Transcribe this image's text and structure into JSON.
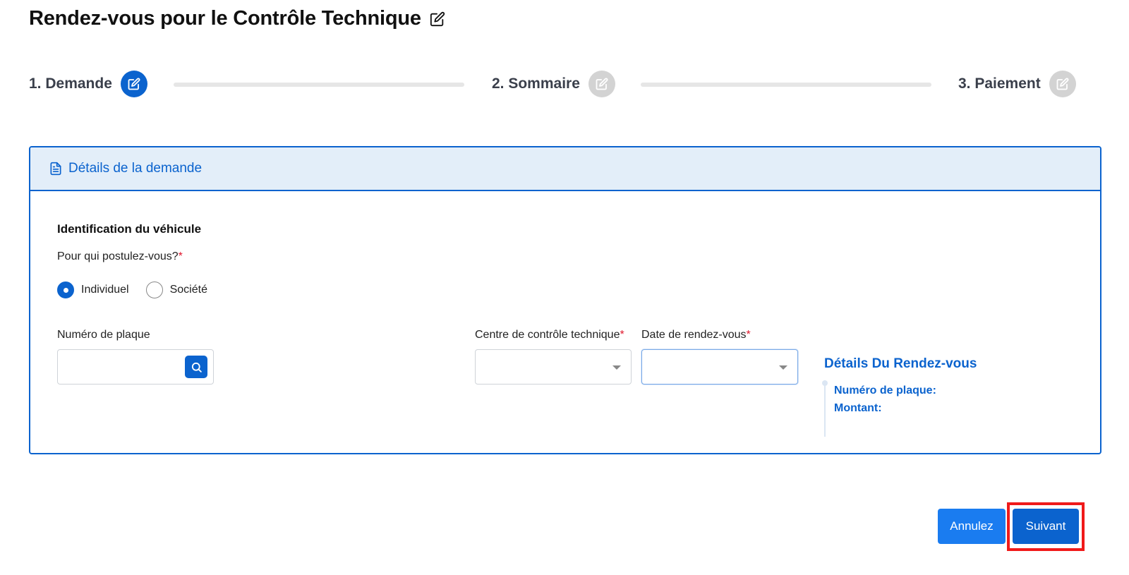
{
  "page": {
    "title": "Rendez-vous pour le Contrôle Technique"
  },
  "stepper": {
    "steps": [
      {
        "label": "1. Demande",
        "state": "active"
      },
      {
        "label": "2. Sommaire",
        "state": "inactive"
      },
      {
        "label": "3. Paiement",
        "state": "inactive"
      }
    ]
  },
  "card": {
    "header_title": "Détails de la demande",
    "section_title": "Identification du véhicule",
    "question": "Pour qui postulez-vous?",
    "required_mark": "*",
    "radios": [
      {
        "label": "Individuel",
        "checked": true
      },
      {
        "label": "Société",
        "checked": false
      }
    ],
    "fields": {
      "plate_label": "Numéro de plaque",
      "plate_value": "",
      "center_label": "Centre de contrôle technique",
      "center_value": "",
      "date_label": "Date de rendez-vous",
      "date_value": ""
    },
    "details": {
      "title": "Détails Du Rendez-vous",
      "plate_row": "Numéro de plaque:",
      "amount_row": "Montant:"
    }
  },
  "footer": {
    "cancel_label": "Annulez",
    "next_label": "Suivant"
  },
  "colors": {
    "primary": "#0b63ce",
    "cancel": "#1a7cf0",
    "highlight": "#f01a1a",
    "required": "#e0182d"
  },
  "icons": {
    "title": "edit-icon",
    "step_active": "edit-icon",
    "card_header": "document-icon",
    "search": "search-icon",
    "dropdown": "caret-down-icon"
  }
}
